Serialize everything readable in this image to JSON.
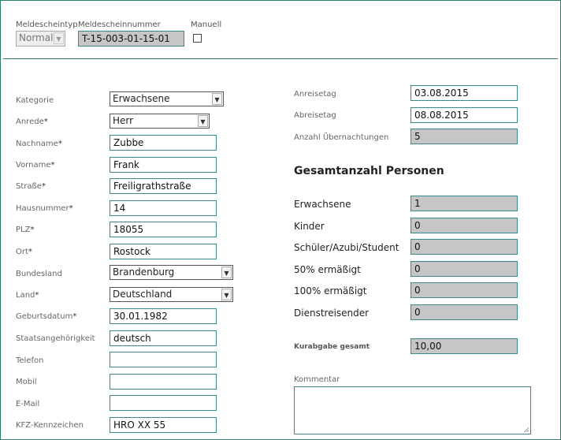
{
  "header": {
    "meldescheintyp_label": "Meldescheintyp",
    "meldescheintyp_value": "Normal",
    "meldescheinnummer_label": "Meldescheinnummer",
    "meldescheinnummer_value": "T-15-003-01-15-01",
    "manuell_label": "Manuell",
    "manuell_checked": false
  },
  "left": {
    "kategorie": {
      "label": "Kategorie",
      "value": "Erwachsene"
    },
    "anrede": {
      "label": "Anrede",
      "value": "Herr"
    },
    "nachname": {
      "label": "Nachname",
      "value": "Zubbe"
    },
    "vorname": {
      "label": "Vorname",
      "value": "Frank"
    },
    "strasse": {
      "label": "Straße",
      "value": "Freiligrathstraße"
    },
    "hausnummer": {
      "label": "Hausnummer",
      "value": "14"
    },
    "plz": {
      "label": "PLZ",
      "value": "18055"
    },
    "ort": {
      "label": "Ort",
      "value": "Rostock"
    },
    "bundesland": {
      "label": "Bundesland",
      "value": "Brandenburg"
    },
    "land": {
      "label": "Land",
      "value": "Deutschland"
    },
    "geburtsdatum": {
      "label": "Geburtsdatum",
      "value": "30.01.1982"
    },
    "staatsangehoerigkeit": {
      "label": "Staatsangehörigkeit",
      "value": "deutsch"
    },
    "telefon": {
      "label": "Telefon",
      "value": ""
    },
    "mobil": {
      "label": "Mobil",
      "value": ""
    },
    "email": {
      "label": "E-Mail",
      "value": ""
    },
    "kfz": {
      "label": "KFZ-Kennzeichen",
      "value": "HRO XX 55"
    },
    "required_marker": "*"
  },
  "right": {
    "anreisetag": {
      "label": "Anreisetag",
      "value": "03.08.2015"
    },
    "abreisetag": {
      "label": "Abreisetag",
      "value": "08.08.2015"
    },
    "uebernachtungen": {
      "label": "Anzahl Übernachtungen",
      "value": "5"
    },
    "personen_heading": "Gesamtanzahl Personen",
    "erwachsene": {
      "label": "Erwachsene",
      "value": "1"
    },
    "kinder": {
      "label": "Kinder",
      "value": "0"
    },
    "schueler": {
      "label": "Schüler/Azubi/Student",
      "value": "0"
    },
    "ermaessigt50": {
      "label": "50% ermäßigt",
      "value": "0"
    },
    "ermaessigt100": {
      "label": "100% ermäßigt",
      "value": "0"
    },
    "dienstreisender": {
      "label": "Dienstreisender",
      "value": "0"
    },
    "kurabgabe": {
      "label": "Kurabgabe gesamt",
      "value": "10,00"
    },
    "kommentar": {
      "label": "Kommentar",
      "value": ""
    }
  },
  "icons": {
    "dropdown": "chevron-down-icon"
  },
  "colors": {
    "border_accent": "#2e7d6b",
    "readonly_fill": "#c6c6c6"
  }
}
